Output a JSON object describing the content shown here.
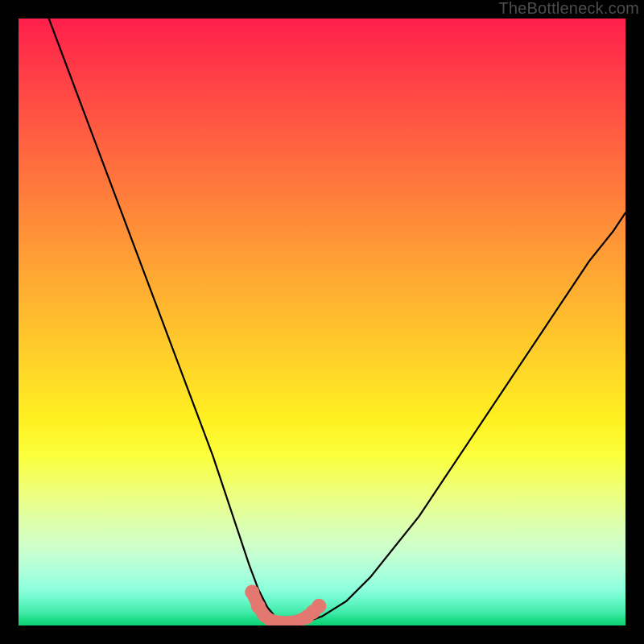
{
  "attribution": "TheBottleneck.com",
  "chart_data": {
    "type": "line",
    "title": "",
    "xlabel": "",
    "ylabel": "",
    "xlim": [
      0,
      100
    ],
    "ylim": [
      0,
      100
    ],
    "grid": false,
    "legend": false,
    "curve": {
      "name": "bottleneck-curve",
      "color": "#000000",
      "x": [
        5,
        8,
        11,
        14,
        17,
        20,
        23,
        26,
        29,
        32,
        34,
        36,
        38,
        39.5,
        41,
        42.5,
        44,
        46,
        48,
        50,
        54,
        58,
        62,
        66,
        70,
        74,
        78,
        82,
        86,
        90,
        94,
        98,
        100
      ],
      "y": [
        100,
        92,
        84,
        76,
        68,
        60,
        52,
        44,
        36,
        28,
        22,
        16,
        10,
        6,
        3,
        1.2,
        0.5,
        0.5,
        0.8,
        1.5,
        4,
        8,
        13,
        18,
        24,
        30,
        36,
        42,
        48,
        54,
        60,
        65,
        68
      ]
    },
    "marker_segment": {
      "name": "bottleneck-highlight",
      "color": "#e2786f",
      "dot_radius": 1.1,
      "thick_radius": 1.4,
      "x": [
        38.5,
        39.5,
        40.5,
        41.5,
        42.5,
        43.5,
        44.5,
        45.5,
        46.5,
        47.5,
        48.5,
        49.5
      ],
      "y": [
        5.5,
        3.2,
        1.6,
        0.9,
        0.6,
        0.5,
        0.5,
        0.6,
        0.9,
        1.4,
        2.2,
        3.2
      ]
    }
  }
}
